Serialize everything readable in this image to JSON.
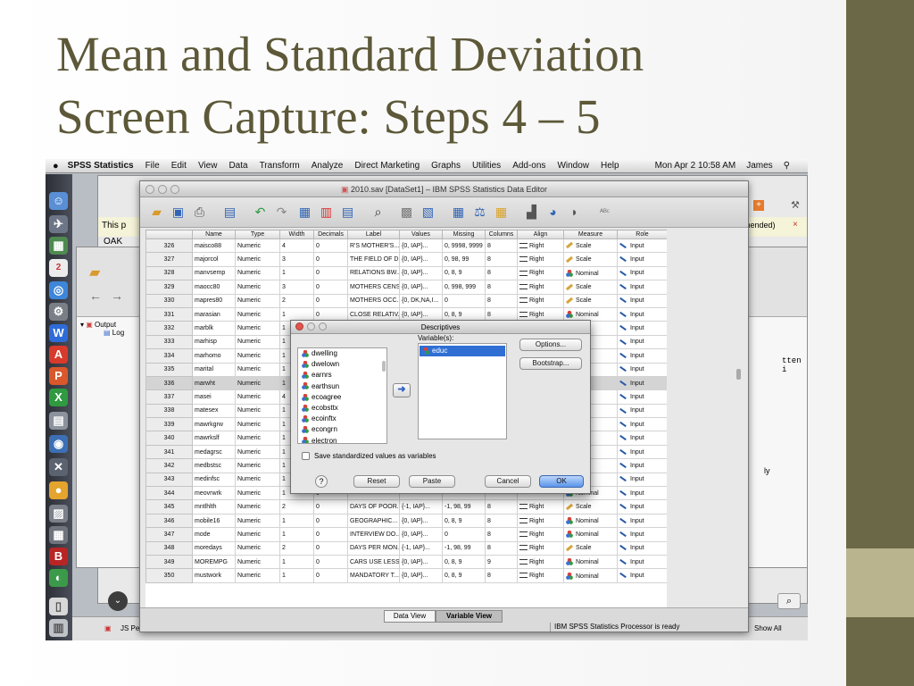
{
  "slide": {
    "title_line1": "Mean and Standard Deviation",
    "title_line2": "Screen Capture: Steps 4 – 5"
  },
  "menubar": {
    "app_name": "SPSS Statistics",
    "items": [
      "File",
      "Edit",
      "View",
      "Data",
      "Transform",
      "Analyze",
      "Direct Marketing",
      "Graphs",
      "Utilities",
      "Add-ons",
      "Window",
      "Help"
    ],
    "clock": "Mon Apr 2  10:58 AM",
    "user": "James"
  },
  "background": {
    "banner_prefix": "This p",
    "banner_right": "nmended)",
    "oak_text": "OAK",
    "output_label": "Output",
    "log_label": "Log",
    "side_text": "tten i",
    "search_icon": "⌕",
    "bottom_left_text": "JS Pee",
    "show_all": "Show All",
    "page_letter": "ly"
  },
  "editor": {
    "title": "2010.sav [DataSet1] – IBM SPSS Statistics Data Editor",
    "columns": [
      "",
      "Name",
      "Type",
      "Width",
      "Decimals",
      "Label",
      "Values",
      "Missing",
      "Columns",
      "Align",
      "Measure",
      "Role"
    ],
    "rows": [
      {
        "n": "326",
        "name": "maisco88",
        "type": "Numeric",
        "width": "4",
        "dec": "0",
        "label": "R'S MOTHER'S...",
        "values": "{0, IAP}...",
        "missing": "0, 9998, 9999",
        "cols": "8",
        "align": "Right",
        "measure": "Scale",
        "role": "Input"
      },
      {
        "n": "327",
        "name": "majorcol",
        "type": "Numeric",
        "width": "3",
        "dec": "0",
        "label": "THE FIELD OF D...",
        "values": "{0, IAP}...",
        "missing": "0, 98, 99",
        "cols": "8",
        "align": "Right",
        "measure": "Scale",
        "role": "Input"
      },
      {
        "n": "328",
        "name": "manvsemp",
        "type": "Numeric",
        "width": "1",
        "dec": "0",
        "label": "RELATIONS BW...",
        "values": "{0, IAP}...",
        "missing": "0, 8, 9",
        "cols": "8",
        "align": "Right",
        "measure": "Nominal",
        "role": "Input"
      },
      {
        "n": "329",
        "name": "maocc80",
        "type": "Numeric",
        "width": "3",
        "dec": "0",
        "label": "MOTHERS CENS...",
        "values": "{0, IAP}...",
        "missing": "0, 998, 999",
        "cols": "8",
        "align": "Right",
        "measure": "Scale",
        "role": "Input"
      },
      {
        "n": "330",
        "name": "mapres80",
        "type": "Numeric",
        "width": "2",
        "dec": "0",
        "label": "MOTHERS OCC...",
        "values": "{0, DK,NA,I...",
        "missing": "0",
        "cols": "8",
        "align": "Right",
        "measure": "Scale",
        "role": "Input"
      },
      {
        "n": "331",
        "name": "marasian",
        "type": "Numeric",
        "width": "1",
        "dec": "0",
        "label": "CLOSE RELATIV...",
        "values": "{0, IAP}...",
        "missing": "0, 8, 9",
        "cols": "8",
        "align": "Right",
        "measure": "Nominal",
        "role": "Input"
      },
      {
        "n": "332",
        "name": "marblk",
        "type": "Numeric",
        "width": "1",
        "dec": "",
        "label": "",
        "values": "",
        "missing": "",
        "cols": "",
        "align": "",
        "measure": "inal",
        "role": "Input"
      },
      {
        "n": "333",
        "name": "marhisp",
        "type": "Numeric",
        "width": "1",
        "dec": "",
        "label": "",
        "values": "",
        "missing": "",
        "cols": "",
        "align": "",
        "measure": "inal",
        "role": "Input"
      },
      {
        "n": "334",
        "name": "marhomo",
        "type": "Numeric",
        "width": "1",
        "dec": "",
        "label": "",
        "values": "",
        "missing": "",
        "cols": "",
        "align": "",
        "measure": "inal",
        "role": "Input"
      },
      {
        "n": "335",
        "name": "marital",
        "type": "Numeric",
        "width": "1",
        "dec": "",
        "label": "",
        "values": "",
        "missing": "",
        "cols": "",
        "align": "",
        "measure": "inal",
        "role": "Input"
      },
      {
        "n": "336",
        "name": "marwht",
        "type": "Numeric",
        "width": "1",
        "dec": "",
        "label": "",
        "values": "",
        "missing": "",
        "cols": "",
        "align": "",
        "measure": "inal",
        "role": "Input"
      },
      {
        "n": "337",
        "name": "masei",
        "type": "Numeric",
        "width": "4",
        "dec": "",
        "label": "",
        "values": "",
        "missing": "",
        "cols": "",
        "align": "",
        "measure": "e",
        "role": "Input"
      },
      {
        "n": "338",
        "name": "matesex",
        "type": "Numeric",
        "width": "1",
        "dec": "",
        "label": "",
        "values": "",
        "missing": "",
        "cols": "",
        "align": "",
        "measure": "inal",
        "role": "Input"
      },
      {
        "n": "339",
        "name": "mawrkgrw",
        "type": "Numeric",
        "width": "1",
        "dec": "",
        "label": "",
        "values": "",
        "missing": "",
        "cols": "",
        "align": "",
        "measure": "inal",
        "role": "Input"
      },
      {
        "n": "340",
        "name": "mawrkslf",
        "type": "Numeric",
        "width": "1",
        "dec": "",
        "label": "",
        "values": "",
        "missing": "",
        "cols": "",
        "align": "",
        "measure": "inal",
        "role": "Input"
      },
      {
        "n": "341",
        "name": "medagrsc",
        "type": "Numeric",
        "width": "1",
        "dec": "",
        "label": "",
        "values": "",
        "missing": "",
        "cols": "",
        "align": "",
        "measure": "inal",
        "role": "Input"
      },
      {
        "n": "342",
        "name": "medbstsc",
        "type": "Numeric",
        "width": "1",
        "dec": "",
        "label": "",
        "values": "",
        "missing": "",
        "cols": "",
        "align": "",
        "measure": "inal",
        "role": "Input"
      },
      {
        "n": "343",
        "name": "medinfsc",
        "type": "Numeric",
        "width": "1",
        "dec": "",
        "label": "",
        "values": "",
        "missing": "",
        "cols": "",
        "align": "",
        "measure": "inal",
        "role": "Input"
      },
      {
        "n": "344",
        "name": "meovrwrk",
        "type": "Numeric",
        "width": "1",
        "dec": "0",
        "label": "",
        "values": "",
        "missing": "",
        "cols": "",
        "align": "",
        "measure": "Nominal",
        "role": "Input"
      },
      {
        "n": "345",
        "name": "mntlhlth",
        "type": "Numeric",
        "width": "2",
        "dec": "0",
        "label": "DAYS OF POOR...",
        "values": "{-1, IAP}...",
        "missing": "-1, 98, 99",
        "cols": "8",
        "align": "Right",
        "measure": "Scale",
        "role": "Input"
      },
      {
        "n": "346",
        "name": "mobile16",
        "type": "Numeric",
        "width": "1",
        "dec": "0",
        "label": "GEOGRAPHIC...",
        "values": "{0, IAP}...",
        "missing": "0, 8, 9",
        "cols": "8",
        "align": "Right",
        "measure": "Nominal",
        "role": "Input"
      },
      {
        "n": "347",
        "name": "mode",
        "type": "Numeric",
        "width": "1",
        "dec": "0",
        "label": "INTERVIEW DO...",
        "values": "{0, IAP}...",
        "missing": "0",
        "cols": "8",
        "align": "Right",
        "measure": "Nominal",
        "role": "Input"
      },
      {
        "n": "348",
        "name": "moredays",
        "type": "Numeric",
        "width": "2",
        "dec": "0",
        "label": "DAYS PER MON...",
        "values": "{-1, IAP}...",
        "missing": "-1, 98, 99",
        "cols": "8",
        "align": "Right",
        "measure": "Scale",
        "role": "Input"
      },
      {
        "n": "349",
        "name": "MOREMPG",
        "type": "Numeric",
        "width": "1",
        "dec": "0",
        "label": "CARS USE LESS...",
        "values": "{0, IAP}...",
        "missing": "0, 8, 9",
        "cols": "9",
        "align": "Right",
        "measure": "Nominal",
        "role": "Input"
      },
      {
        "n": "350",
        "name": "mustwork",
        "type": "Numeric",
        "width": "1",
        "dec": "0",
        "label": "MANDATORY T...",
        "values": "{0, IAP}...",
        "missing": "0, 8, 9",
        "cols": "8",
        "align": "Right",
        "measure": "Nominal",
        "role": "Input"
      }
    ],
    "tab_data_view": "Data View",
    "tab_variable_view": "Variable View",
    "status": "IBM SPSS Statistics Processor is ready"
  },
  "dialog": {
    "title": "Descriptives",
    "source_vars": [
      "dwelling",
      "dwelown",
      "earnrs",
      "earthsun",
      "ecoagree",
      "ecobsttx",
      "ecoinftx",
      "econgrn",
      "electron"
    ],
    "variables_label": "Variable(s):",
    "selected_vars": [
      "educ"
    ],
    "options_btn": "Options...",
    "bootstrap_btn": "Bootstrap...",
    "save_std_label": "Save standardized values as variables",
    "help_btn": "?",
    "reset_btn": "Reset",
    "paste_btn": "Paste",
    "cancel_btn": "Cancel",
    "ok_btn": "OK"
  }
}
